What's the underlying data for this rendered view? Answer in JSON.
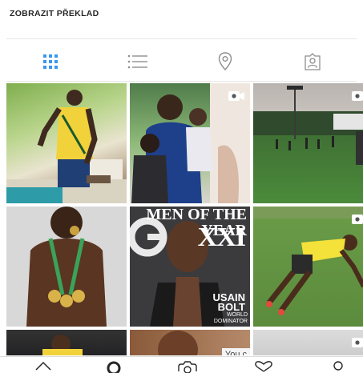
{
  "header": {
    "translate_label": "ZOBRAZIT PŘEKLAD"
  },
  "tabs": [
    {
      "icon": "grid-icon",
      "active": true
    },
    {
      "icon": "list-icon",
      "active": false
    },
    {
      "icon": "location-pin-icon",
      "active": false
    },
    {
      "icon": "tagged-user-icon",
      "active": false
    }
  ],
  "colors": {
    "accent": "#3897f0",
    "icon_gray": "#8e8e8e",
    "text": "#262626"
  },
  "posts": [
    {
      "id": "post-1",
      "video": false
    },
    {
      "id": "post-2",
      "video": true
    },
    {
      "id": "post-3",
      "video": true
    },
    {
      "id": "post-4",
      "video": false
    },
    {
      "id": "post-5",
      "video": false
    },
    {
      "id": "post-6",
      "video": true
    },
    {
      "id": "post-7",
      "video": false
    },
    {
      "id": "post-8",
      "video": false
    },
    {
      "id": "post-9",
      "video": true
    }
  ],
  "magazine": {
    "top": "MEN OF THE YEAR",
    "big": "XXI",
    "name_line1": "USAIN",
    "name_line2": "BOLT",
    "tag_line1": "WORLD",
    "tag_line2": "DOMINATOR"
  },
  "post8": {
    "caption": "You c"
  },
  "bottom_nav": [
    "home-icon",
    "search-icon",
    "camera-icon",
    "heart-icon",
    "profile-icon"
  ]
}
